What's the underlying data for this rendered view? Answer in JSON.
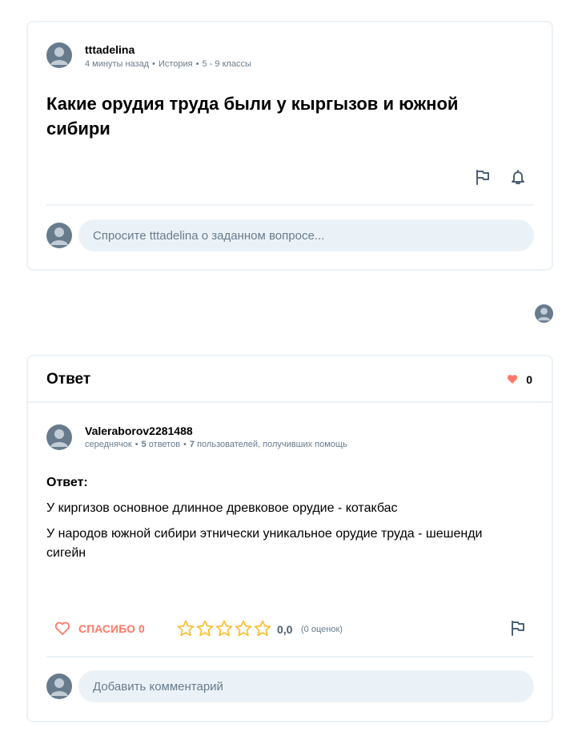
{
  "question": {
    "author": "tttadelina",
    "time": "4 минуты назад",
    "subject": "История",
    "grade": "5 - 9 классы",
    "title": "Какие орудия труда были у кыргызов и южной сибири",
    "comment_placeholder": "Спросите tttadelina о заданном вопросе..."
  },
  "answer": {
    "header_title": "Ответ",
    "likes_count": "0",
    "author": "Valeraborov2281488",
    "rank": "середнячок",
    "answers_count": "5",
    "answers_label": "ответов",
    "helped_count": "7",
    "helped_label": "пользователей, получивших помощь",
    "body_label": "Ответ:",
    "paragraphs": [
      "У киргизов основное длинное древковое орудие - котакбас",
      "У народов южной сибири этнически уникальное орудие труда - шешенди сигейн"
    ],
    "thanks_label": "СПАСИБО 0",
    "rating_value": "0,0",
    "rating_count": "(0 оценок)",
    "stars_filled": 0,
    "stars_total": 5,
    "comment_placeholder": "Добавить комментарий"
  },
  "icons": {
    "report": "flag-icon",
    "follow": "bell-icon",
    "like": "heart-icon",
    "star": "star-outline-icon",
    "avatar": "user-avatar-icon"
  },
  "colors": {
    "border": "#ebf2f7",
    "muted_text": "#687b8c",
    "accent_red": "#ff7968",
    "star_yellow": "#fbbe2e",
    "input_bg": "#ebf2f7"
  }
}
